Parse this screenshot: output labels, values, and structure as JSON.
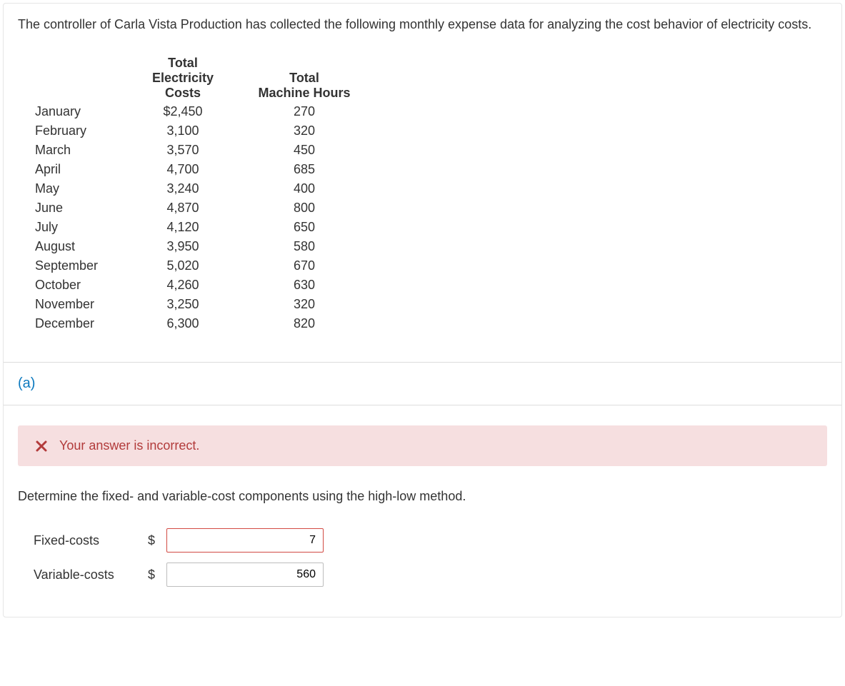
{
  "problem_text": "The controller of Carla Vista Production has collected the following monthly expense data for analyzing the cost behavior of electricity costs.",
  "table": {
    "headers": {
      "col1_line1": "Total",
      "col1_line2": "Electricity Costs",
      "col2_line1": "Total",
      "col2_line2": "Machine Hours"
    },
    "rows": [
      {
        "month": "January",
        "cost": "$2,450",
        "hours": "270"
      },
      {
        "month": "February",
        "cost": "3,100",
        "hours": "320"
      },
      {
        "month": "March",
        "cost": "3,570",
        "hours": "450"
      },
      {
        "month": "April",
        "cost": "4,700",
        "hours": "685"
      },
      {
        "month": "May",
        "cost": "3,240",
        "hours": "400"
      },
      {
        "month": "June",
        "cost": "4,870",
        "hours": "800"
      },
      {
        "month": "July",
        "cost": "4,120",
        "hours": "650"
      },
      {
        "month": "August",
        "cost": "3,950",
        "hours": "580"
      },
      {
        "month": "September",
        "cost": "5,020",
        "hours": "670"
      },
      {
        "month": "October",
        "cost": "4,260",
        "hours": "630"
      },
      {
        "month": "November",
        "cost": "3,250",
        "hours": "320"
      },
      {
        "month": "December",
        "cost": "6,300",
        "hours": "820"
      }
    ]
  },
  "part_label": "(a)",
  "feedback_text": "Your answer is incorrect.",
  "instruction": "Determine the fixed- and variable-cost components using the high-low method.",
  "answers": {
    "fixed_label": "Fixed-costs",
    "fixed_currency": "$",
    "fixed_value": "7",
    "variable_label": "Variable-costs",
    "variable_currency": "$",
    "variable_value": "560"
  }
}
